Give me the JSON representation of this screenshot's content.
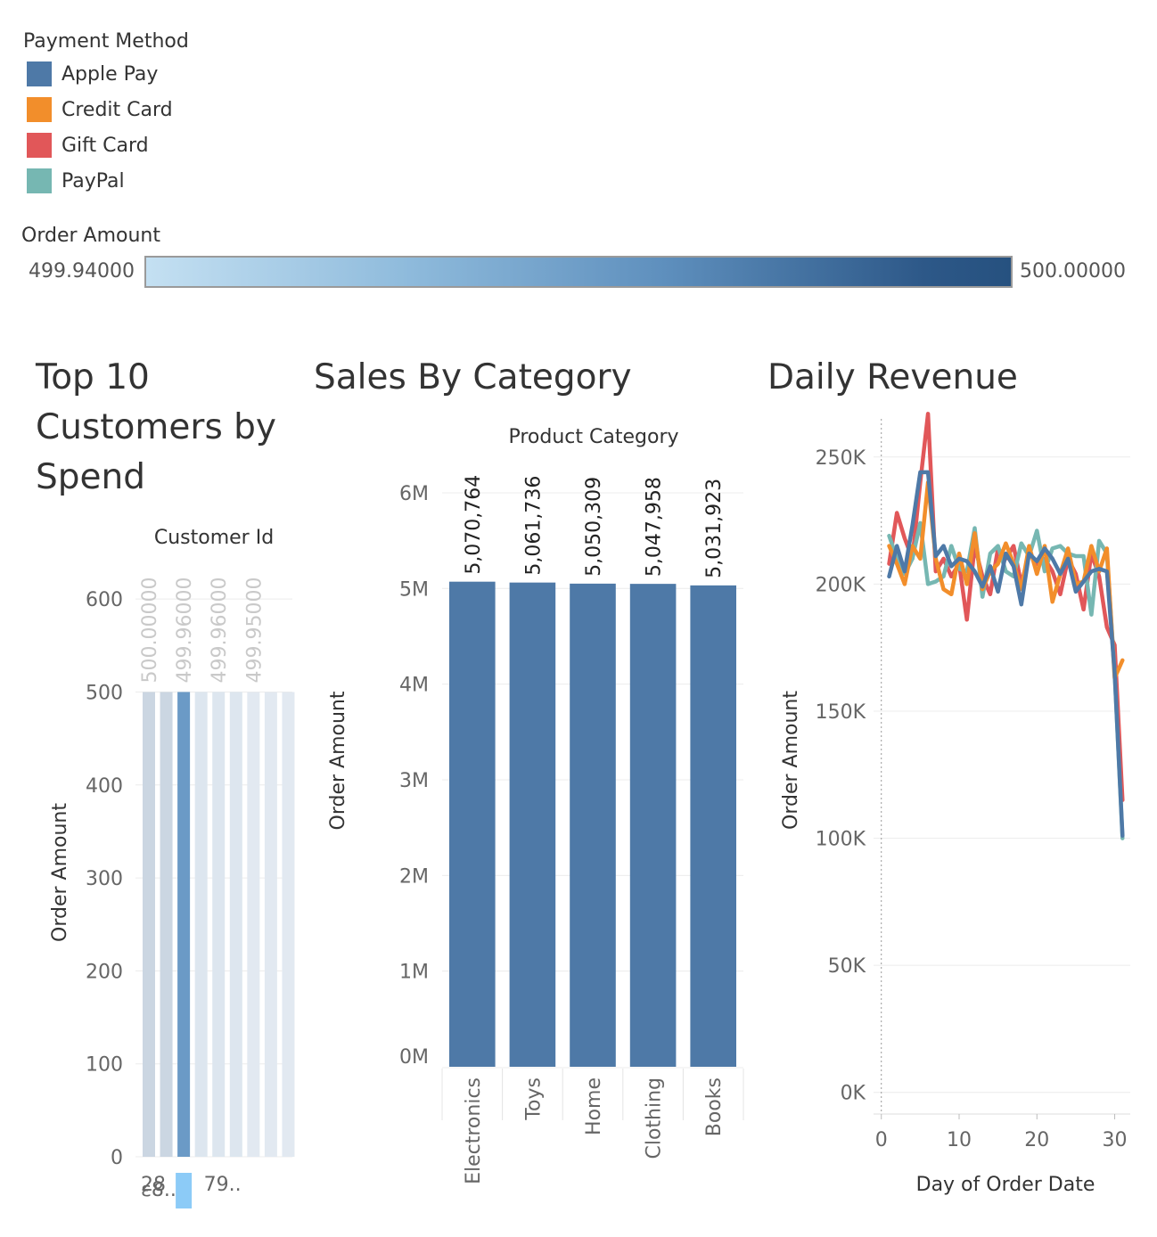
{
  "legend": {
    "title": "Payment Method",
    "items": [
      {
        "label": "Apple Pay",
        "color": "#4e79a7"
      },
      {
        "label": "Credit Card",
        "color": "#f28e2b"
      },
      {
        "label": "Gift Card",
        "color": "#e15759"
      },
      {
        "label": "PayPal",
        "color": "#76b7b2"
      }
    ]
  },
  "color_legend": {
    "title": "Order Amount",
    "min_label": "499.94000",
    "max_label": "500.00000",
    "color_low": "#c4e0f2",
    "color_high": "#26517f"
  },
  "titles": {
    "customers": "Top 10 Customers by Spend",
    "category": "Sales By Category",
    "daily": "Daily Revenue"
  },
  "chart_data": [
    {
      "type": "bar",
      "title": "Top 10 Customers by Spend",
      "xlabel": "Customer Id",
      "ylabel": "Order Amount",
      "ylim": [
        0,
        650
      ],
      "yticks": [
        0,
        100,
        200,
        300,
        400,
        500,
        600
      ],
      "grid": true,
      "values": [
        500,
        500,
        500,
        499.96,
        499.96,
        499.96,
        499.96,
        499.95,
        499.95
      ],
      "data_labels": [
        "500.00000",
        "",
        "499.96000",
        "",
        "499.96000",
        "",
        "499.95000",
        "",
        ""
      ],
      "bar_colors": [
        "#cbd6e2",
        "#cbd6e2",
        "#6b9ac6",
        "#dde6ef",
        "#dde6ef",
        "#dde6ef",
        "#e2e9f1",
        "#e2e9f1",
        "#e2e9f1"
      ],
      "highlight_index": 2,
      "tick_labels": [
        {
          "text": "28",
          "index": 0
        },
        {
          "text": "ε8..",
          "index": 0
        },
        {
          "text": "79..",
          "index": 3
        }
      ]
    },
    {
      "type": "bar",
      "title": "Sales By Category",
      "xlabel": "Product Category",
      "ylabel": "Order Amount",
      "categories": [
        "Electronics",
        "Toys",
        "Home",
        "Clothing",
        "Books"
      ],
      "values": [
        5070764,
        5061736,
        5050309,
        5047958,
        5031923
      ],
      "data_labels": [
        "5,070,764",
        "5,061,736",
        "5,050,309",
        "5,047,958",
        "5,031,923"
      ],
      "ylim": [
        0,
        6400000
      ],
      "yticks": [
        0,
        1000000,
        2000000,
        3000000,
        4000000,
        5000000,
        6000000
      ],
      "ytick_labels": [
        "0M",
        "1M",
        "2M",
        "3M",
        "4M",
        "5M",
        "6M"
      ],
      "color": "#4e79a7",
      "grid": true
    },
    {
      "type": "line",
      "title": "Daily Revenue",
      "xlabel": "Day of Order Date",
      "ylabel": "Order Amount",
      "xlim": [
        -1,
        32
      ],
      "xticks": [
        0,
        10,
        20,
        30
      ],
      "ylim": [
        -5000,
        265000
      ],
      "yticks": [
        0,
        50000,
        100000,
        150000,
        200000,
        250000
      ],
      "ytick_labels": [
        "0K",
        "50K",
        "100K",
        "150K",
        "200K",
        "250K"
      ],
      "grid": true,
      "series": [
        {
          "name": "Gift Card",
          "color": "#e15759",
          "x": [
            1,
            2,
            3,
            4,
            5,
            6,
            7,
            8,
            9,
            10,
            11,
            12,
            13,
            14,
            15,
            16,
            17,
            18,
            19,
            20,
            21,
            22,
            23,
            24,
            25,
            26,
            27,
            28,
            29,
            30,
            31
          ],
          "y": [
            208000,
            228000,
            218000,
            210000,
            240000,
            267000,
            205000,
            210000,
            203000,
            208000,
            186000,
            215000,
            203000,
            196000,
            214000,
            210000,
            215000,
            200000,
            212000,
            208000,
            210000,
            205000,
            196000,
            210000,
            204000,
            190000,
            212000,
            203000,
            183000,
            176000,
            115000
          ]
        },
        {
          "name": "PayPal",
          "color": "#76b7b2",
          "x": [
            1,
            2,
            3,
            4,
            5,
            6,
            7,
            8,
            9,
            10,
            11,
            12,
            13,
            14,
            15,
            16,
            17,
            18,
            19,
            20,
            21,
            22,
            23,
            24,
            25,
            26,
            27,
            28,
            29,
            30,
            31
          ],
          "y": [
            219000,
            210000,
            204000,
            210000,
            224000,
            200000,
            201000,
            203000,
            215000,
            206000,
            205000,
            222000,
            195000,
            212000,
            215000,
            205000,
            203000,
            216000,
            211000,
            221000,
            205000,
            214000,
            215000,
            212000,
            211000,
            211000,
            188000,
            217000,
            212000,
            165000,
            100000
          ]
        },
        {
          "name": "Credit Card",
          "color": "#f28e2b",
          "x": [
            1,
            2,
            3,
            4,
            5,
            6,
            7,
            8,
            9,
            10,
            11,
            12,
            13,
            14,
            15,
            16,
            17,
            18,
            19,
            20,
            21,
            22,
            23,
            24,
            25,
            26,
            27,
            28,
            29,
            30,
            31
          ],
          "y": [
            215000,
            208000,
            200000,
            215000,
            210000,
            240000,
            210000,
            198000,
            196000,
            212000,
            200000,
            220000,
            198000,
            205000,
            208000,
            216000,
            208000,
            198000,
            215000,
            204000,
            215000,
            193000,
            204000,
            214000,
            200000,
            201000,
            215000,
            205000,
            214000,
            163000,
            170000
          ]
        },
        {
          "name": "Apple Pay",
          "color": "#4e79a7",
          "x": [
            1,
            2,
            3,
            4,
            5,
            6,
            7,
            8,
            9,
            10,
            11,
            12,
            13,
            14,
            15,
            16,
            17,
            18,
            19,
            20,
            21,
            22,
            23,
            24,
            25,
            26,
            27,
            28,
            29,
            30,
            31
          ],
          "y": [
            203000,
            215000,
            205000,
            223000,
            244000,
            244000,
            211000,
            215000,
            207000,
            210000,
            209000,
            205000,
            199000,
            207000,
            197000,
            212000,
            207000,
            192000,
            212000,
            209000,
            214000,
            210000,
            204000,
            210000,
            197000,
            201000,
            205000,
            206000,
            205000,
            165000,
            101000
          ]
        }
      ]
    }
  ]
}
